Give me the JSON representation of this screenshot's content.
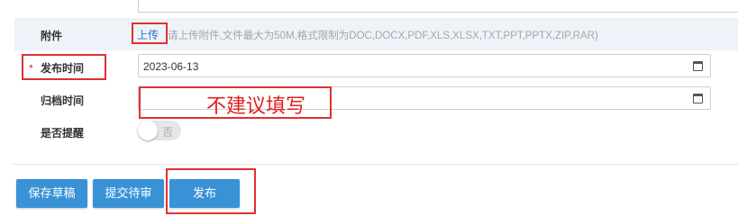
{
  "form": {
    "attachment": {
      "label": "附件",
      "upload_link": "上传",
      "hint": "请上传附件,文件最大为50M,格式限制为DOC,DOCX,PDF,XLS,XLSX,TXT,PPT,PPTX,ZIP,RAR)"
    },
    "publish_time": {
      "required_mark": "*",
      "label": "发布时间",
      "value": "2023-06-13",
      "icon": "calendar-icon"
    },
    "archive_time": {
      "label": "归档时间",
      "value": "",
      "icon": "calendar-icon"
    },
    "reminder": {
      "label": "是否提醒",
      "toggle_text": "否",
      "on": false
    }
  },
  "annotation": {
    "text": "不建议填写",
    "color": "#e03030"
  },
  "buttons": {
    "save_draft": "保存草稿",
    "submit_review": "提交待审",
    "publish": "发布"
  },
  "colors": {
    "button": "#3a92d6",
    "link": "#2a73c5",
    "attach_row_bg": "#eef3f9"
  }
}
